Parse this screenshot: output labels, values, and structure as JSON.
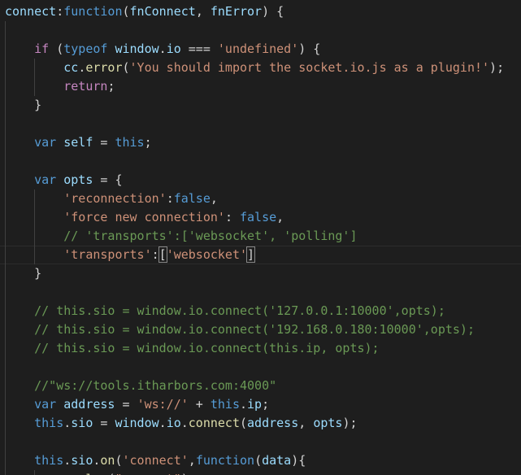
{
  "code_lines": [
    [
      {
        "t": "connect",
        "c": "var"
      },
      {
        "t": ":",
        "c": "pl"
      },
      {
        "t": "function",
        "c": "kw"
      },
      {
        "t": "(",
        "c": "pl"
      },
      {
        "t": "fnConnect",
        "c": "var"
      },
      {
        "t": ", ",
        "c": "pl"
      },
      {
        "t": "fnError",
        "c": "var"
      },
      {
        "t": ") {",
        "c": "pl"
      }
    ],
    [],
    [
      {
        "t": "    ",
        "c": "pl"
      },
      {
        "t": "if",
        "c": "ctl"
      },
      {
        "t": " (",
        "c": "pl"
      },
      {
        "t": "typeof",
        "c": "kw"
      },
      {
        "t": " ",
        "c": "pl"
      },
      {
        "t": "window",
        "c": "var"
      },
      {
        "t": ".",
        "c": "pl"
      },
      {
        "t": "io",
        "c": "var"
      },
      {
        "t": " === ",
        "c": "pl"
      },
      {
        "t": "'undefined'",
        "c": "str"
      },
      {
        "t": ") {",
        "c": "pl"
      }
    ],
    [
      {
        "t": "        ",
        "c": "pl"
      },
      {
        "t": "cc",
        "c": "var"
      },
      {
        "t": ".",
        "c": "pl"
      },
      {
        "t": "error",
        "c": "fn"
      },
      {
        "t": "(",
        "c": "pl"
      },
      {
        "t": "'You should import the socket.io.js as a plugin!'",
        "c": "str"
      },
      {
        "t": ");",
        "c": "pl"
      }
    ],
    [
      {
        "t": "        ",
        "c": "pl"
      },
      {
        "t": "return",
        "c": "ctl"
      },
      {
        "t": ";",
        "c": "pl"
      }
    ],
    [
      {
        "t": "    }",
        "c": "pl"
      }
    ],
    [],
    [
      {
        "t": "    ",
        "c": "pl"
      },
      {
        "t": "var",
        "c": "kw"
      },
      {
        "t": " ",
        "c": "pl"
      },
      {
        "t": "self",
        "c": "var"
      },
      {
        "t": " = ",
        "c": "pl"
      },
      {
        "t": "this",
        "c": "kw"
      },
      {
        "t": ";",
        "c": "pl"
      }
    ],
    [],
    [
      {
        "t": "    ",
        "c": "pl"
      },
      {
        "t": "var",
        "c": "kw"
      },
      {
        "t": " ",
        "c": "pl"
      },
      {
        "t": "opts",
        "c": "var"
      },
      {
        "t": " = {",
        "c": "pl"
      }
    ],
    [
      {
        "t": "        ",
        "c": "pl"
      },
      {
        "t": "'reconnection'",
        "c": "str"
      },
      {
        "t": ":",
        "c": "pl"
      },
      {
        "t": "false",
        "c": "kw"
      },
      {
        "t": ",",
        "c": "pl"
      }
    ],
    [
      {
        "t": "        ",
        "c": "pl"
      },
      {
        "t": "'force new connection'",
        "c": "str"
      },
      {
        "t": ": ",
        "c": "pl"
      },
      {
        "t": "false",
        "c": "kw"
      },
      {
        "t": ",",
        "c": "pl"
      }
    ],
    [
      {
        "t": "        ",
        "c": "pl"
      },
      {
        "t": "// 'transports':['websocket', 'polling']",
        "c": "cmt"
      }
    ],
    [
      {
        "t": "        ",
        "c": "pl"
      },
      {
        "t": "'transports'",
        "c": "str"
      },
      {
        "t": ":",
        "c": "pl"
      },
      {
        "t": "[",
        "c": "pl",
        "b": 1
      },
      {
        "t": "'websocket'",
        "c": "str"
      },
      {
        "t": "]",
        "c": "pl",
        "b": 1
      }
    ],
    [
      {
        "t": "    }",
        "c": "pl"
      }
    ],
    [],
    [
      {
        "t": "    ",
        "c": "pl"
      },
      {
        "t": "// this.sio = window.io.connect('127.0.0.1:10000',opts);",
        "c": "cmt"
      }
    ],
    [
      {
        "t": "    ",
        "c": "pl"
      },
      {
        "t": "// this.sio = window.io.connect('192.168.0.180:10000',opts);",
        "c": "cmt"
      }
    ],
    [
      {
        "t": "    ",
        "c": "pl"
      },
      {
        "t": "// this.sio = window.io.connect(this.ip, opts);",
        "c": "cmt"
      }
    ],
    [],
    [
      {
        "t": "    ",
        "c": "pl"
      },
      {
        "t": "//\"ws://tools.itharbors.com:4000\"",
        "c": "cmt"
      }
    ],
    [
      {
        "t": "    ",
        "c": "pl"
      },
      {
        "t": "var",
        "c": "kw"
      },
      {
        "t": " ",
        "c": "pl"
      },
      {
        "t": "address",
        "c": "var"
      },
      {
        "t": " = ",
        "c": "pl"
      },
      {
        "t": "'ws://'",
        "c": "str"
      },
      {
        "t": " + ",
        "c": "pl"
      },
      {
        "t": "this",
        "c": "kw"
      },
      {
        "t": ".",
        "c": "pl"
      },
      {
        "t": "ip",
        "c": "var"
      },
      {
        "t": ";",
        "c": "pl"
      }
    ],
    [
      {
        "t": "    ",
        "c": "pl"
      },
      {
        "t": "this",
        "c": "kw"
      },
      {
        "t": ".",
        "c": "pl"
      },
      {
        "t": "sio",
        "c": "var"
      },
      {
        "t": " = ",
        "c": "pl"
      },
      {
        "t": "window",
        "c": "var"
      },
      {
        "t": ".",
        "c": "pl"
      },
      {
        "t": "io",
        "c": "var"
      },
      {
        "t": ".",
        "c": "pl"
      },
      {
        "t": "connect",
        "c": "fn"
      },
      {
        "t": "(",
        "c": "pl"
      },
      {
        "t": "address",
        "c": "var"
      },
      {
        "t": ", ",
        "c": "pl"
      },
      {
        "t": "opts",
        "c": "var"
      },
      {
        "t": ");",
        "c": "pl"
      }
    ],
    [],
    [
      {
        "t": "    ",
        "c": "pl"
      },
      {
        "t": "this",
        "c": "kw"
      },
      {
        "t": ".",
        "c": "pl"
      },
      {
        "t": "sio",
        "c": "var"
      },
      {
        "t": ".",
        "c": "pl"
      },
      {
        "t": "on",
        "c": "fn"
      },
      {
        "t": "(",
        "c": "pl"
      },
      {
        "t": "'connect'",
        "c": "str"
      },
      {
        "t": ",",
        "c": "pl"
      },
      {
        "t": "function",
        "c": "kw"
      },
      {
        "t": "(",
        "c": "pl"
      },
      {
        "t": "data",
        "c": "var"
      },
      {
        "t": "){",
        "c": "pl"
      }
    ],
    [
      {
        "t": "        ",
        "c": "pl"
      },
      {
        "t": "cc",
        "c": "var"
      },
      {
        "t": ".",
        "c": "pl"
      },
      {
        "t": "log",
        "c": "fn"
      },
      {
        "t": "(",
        "c": "pl"
      },
      {
        "t": "\"connect\"",
        "c": "str"
      },
      {
        "t": ");",
        "c": "pl"
      }
    ]
  ],
  "current_line_index": 13,
  "colors": {
    "background": "#1e1e1e",
    "keyword": "#569cd6",
    "control": "#c586c0",
    "string": "#ce9178",
    "comment": "#6a9955",
    "variable": "#9cdcfe",
    "function": "#dcdcaa",
    "plain": "#d4d4d4"
  }
}
